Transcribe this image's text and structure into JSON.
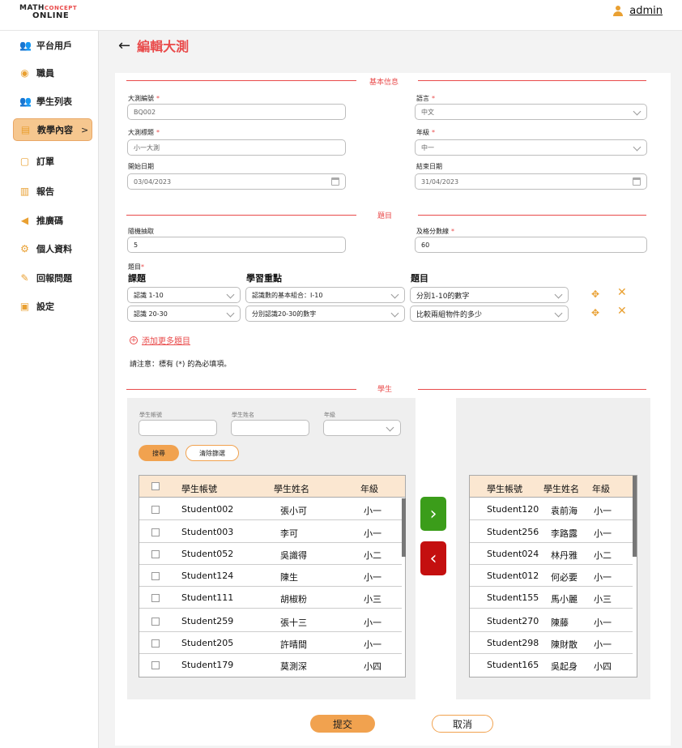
{
  "app": {
    "logo_line1_a": "MATH",
    "logo_line1_b": "CONCEPT",
    "logo_line2": "ONLINE",
    "user": "admin"
  },
  "sidebar": {
    "items": [
      {
        "label": "平台用戶",
        "icon": "users-icon"
      },
      {
        "label": "職員",
        "icon": "staff-icon"
      },
      {
        "label": "學生列表",
        "icon": "students-icon"
      },
      {
        "label": "教學內容",
        "icon": "content-icon",
        "active": true,
        "chevron": ">"
      },
      {
        "label": "訂單",
        "icon": "order-icon"
      },
      {
        "label": "報告",
        "icon": "report-icon"
      },
      {
        "label": "推廣碼",
        "icon": "megaphone-icon"
      },
      {
        "label": "個人資料",
        "icon": "profile-gear-icon"
      },
      {
        "label": "回報問題",
        "icon": "feedback-icon"
      },
      {
        "label": "設定",
        "icon": "settings-icon"
      }
    ]
  },
  "page": {
    "back": "←",
    "title": "編輯大測"
  },
  "basic": {
    "section_title": "基本信息",
    "code_label": "大測編號",
    "code_value": "BQ002",
    "lang_label": "語言",
    "lang_value": "中文",
    "title_label": "大測標題",
    "title_value": "小一大測",
    "grade_label": "年級",
    "grade_value": "中一",
    "start_label": "開始日期",
    "start_value": "03/04/2023",
    "end_label": "結束日期",
    "end_value": "31/04/2023",
    "req": "*"
  },
  "questions": {
    "section_title": "題目",
    "random_label": "隨機抽取",
    "random_value": "5",
    "pass_label": "及格分數線",
    "pass_value": "60",
    "q_label": "題目",
    "col_topic": "課題",
    "col_focus": "學習重點",
    "col_question": "題目",
    "rows": [
      {
        "topic": "認識 1-10",
        "focus": "認識數的基本組合：I-10",
        "question": "分別1-10的數字"
      },
      {
        "topic": "認識 20-30",
        "focus": "分別認識20-30的數字",
        "question": "比較兩組物件的多少"
      }
    ],
    "add_more": "添加更多題目",
    "note": "請注意：標有 (*) 的為必填項。"
  },
  "students": {
    "section_title": "學生",
    "filter_account": "學生帳號",
    "filter_name": "學生姓名",
    "filter_grade": "年級",
    "search_btn": "搜尋",
    "clear_btn": "清除篩選",
    "col_account": "學生帳號",
    "col_name": "學生姓名",
    "col_grade": "年級",
    "left_rows": [
      {
        "account": "Student002",
        "name": "張小可",
        "grade": "小一"
      },
      {
        "account": "Student003",
        "name": "李可",
        "grade": "小一"
      },
      {
        "account": "Student052",
        "name": "吳識得",
        "grade": "小二"
      },
      {
        "account": "Student124",
        "name": "陳生",
        "grade": "小一"
      },
      {
        "account": "Student111",
        "name": "胡椒粉",
        "grade": "小三"
      },
      {
        "account": "Student259",
        "name": "張十三",
        "grade": "小一"
      },
      {
        "account": "Student205",
        "name": "許晴間",
        "grade": "小一"
      },
      {
        "account": "Student179",
        "name": "莫測深",
        "grade": "小四"
      }
    ],
    "right_rows": [
      {
        "account": "Student120",
        "name": "袁前海",
        "grade": "小一"
      },
      {
        "account": "Student256",
        "name": "李路露",
        "grade": "小一"
      },
      {
        "account": "Student024",
        "name": "林丹雅",
        "grade": "小二"
      },
      {
        "account": "Student012",
        "name": "何必要",
        "grade": "小一"
      },
      {
        "account": "Student155",
        "name": "馬小麗",
        "grade": "小三"
      },
      {
        "account": "Student270",
        "name": "陳藤",
        "grade": "小一"
      },
      {
        "account": "Student298",
        "name": "陳財散",
        "grade": "小一"
      },
      {
        "account": "Student165",
        "name": "吳起身",
        "grade": "小四"
      }
    ],
    "move_right": "›",
    "move_left": "‹"
  },
  "actions": {
    "submit": "提交",
    "cancel": "取消"
  },
  "colors": {
    "accent": "#e94b4b",
    "orange": "#f1a24f",
    "green": "#3b9d1a",
    "red": "#c40f0f"
  }
}
